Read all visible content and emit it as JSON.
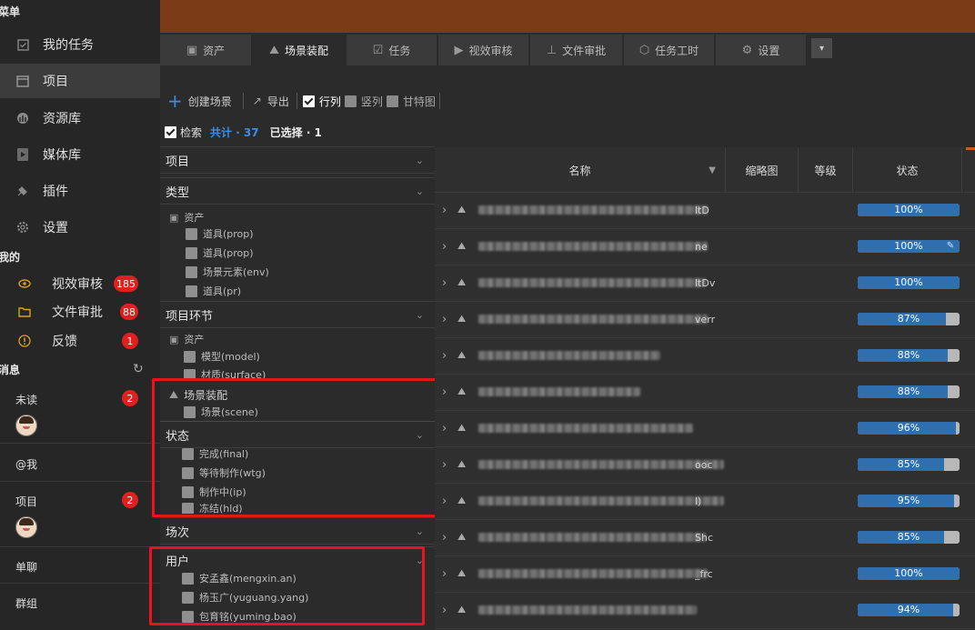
{
  "sidebar": {
    "menu_title": "菜单",
    "nav": [
      {
        "label": "我的任务",
        "icon": "check-icon"
      },
      {
        "label": "项目",
        "icon": "window-icon"
      },
      {
        "label": "资源库",
        "icon": "resource-icon"
      },
      {
        "label": "媒体库",
        "icon": "play-icon"
      },
      {
        "label": "插件",
        "icon": "plugin-icon"
      },
      {
        "label": "设置",
        "icon": "gear-icon"
      }
    ],
    "mine_title": "我的",
    "mine": [
      {
        "label": "视效审核",
        "badge": "185",
        "icon": "eye-icon"
      },
      {
        "label": "文件审批",
        "badge": "88",
        "icon": "folder-icon"
      },
      {
        "label": "反馈",
        "badge": "1",
        "icon": "alert-icon"
      }
    ],
    "messages_title": "消息",
    "messages": [
      {
        "label": "未读",
        "badge": "2"
      },
      {
        "label": "@我"
      },
      {
        "label": "项目",
        "badge": "2"
      },
      {
        "label": "单聊"
      },
      {
        "label": "群组"
      }
    ]
  },
  "tabs": [
    {
      "label": "资产",
      "icon": "asset-icon"
    },
    {
      "label": "场景装配",
      "icon": "mountain-icon"
    },
    {
      "label": "任务",
      "icon": "checkbox-icon"
    },
    {
      "label": "视效审核",
      "icon": "video-icon"
    },
    {
      "label": "文件审批",
      "icon": "stamp-icon"
    },
    {
      "label": "任务工时",
      "icon": "clock-icon"
    },
    {
      "label": "设置",
      "icon": "gear-icon"
    }
  ],
  "toolbar": {
    "create": "创建场景",
    "export": "导出",
    "row_view": "行列",
    "col_view": "竖列",
    "gantt": "甘特图"
  },
  "search_row": {
    "label": "检索",
    "total": "共计 · 37",
    "selected": "已选择 · 1"
  },
  "filters": {
    "project": "项目",
    "type": "类型",
    "type_group": "资产",
    "type_options": [
      "道具(prop)",
      "道具(prop)",
      "场景元素(env)",
      "道具(pr)"
    ],
    "stage": "项目环节",
    "stage_group": "资产",
    "stage_options": [
      "模型(model)",
      "材质(surface)"
    ],
    "scene_group": "场景装配",
    "scene_options": [
      "场景(scene)"
    ],
    "status": "状态",
    "status_options": [
      "完成(final)",
      "等待制作(wtg)",
      "制作中(ip)",
      "冻结(hld)"
    ],
    "shot": "场次",
    "user": "用户",
    "user_options": [
      "安孟鑫(mengxin.an)",
      "杨玉广(yuguang.yang)",
      "包育铭(yuming.bao)"
    ]
  },
  "table": {
    "headers": {
      "name": "名称",
      "thumb": "缩略图",
      "level": "等级",
      "status": "状态"
    },
    "rows": [
      {
        "tail": "ltD",
        "progress": 100,
        "label": "100%"
      },
      {
        "tail": "ne",
        "progress": 100,
        "label": "100%"
      },
      {
        "tail": "ltDv",
        "progress": 100,
        "label": "100%"
      },
      {
        "tail": "verr",
        "progress": 87,
        "label": "87%"
      },
      {
        "tail": "",
        "progress": 88,
        "label": "88%"
      },
      {
        "tail": "",
        "progress": 88,
        "label": "88%"
      },
      {
        "tail": "",
        "progress": 96,
        "label": "96%"
      },
      {
        "tail": "ooc",
        "progress": 85,
        "label": "85%"
      },
      {
        "tail": "l)",
        "progress": 95,
        "label": "95%"
      },
      {
        "tail": "Shc",
        "progress": 85,
        "label": "85%"
      },
      {
        "tail": "_frc",
        "progress": 100,
        "label": "100%"
      },
      {
        "tail": "",
        "progress": 94,
        "label": "94%"
      }
    ]
  },
  "colors": {
    "accent": "#2f6fb0",
    "badge": "#e02020",
    "topbar": "#7b3b16",
    "highlight": "#e8141b"
  }
}
